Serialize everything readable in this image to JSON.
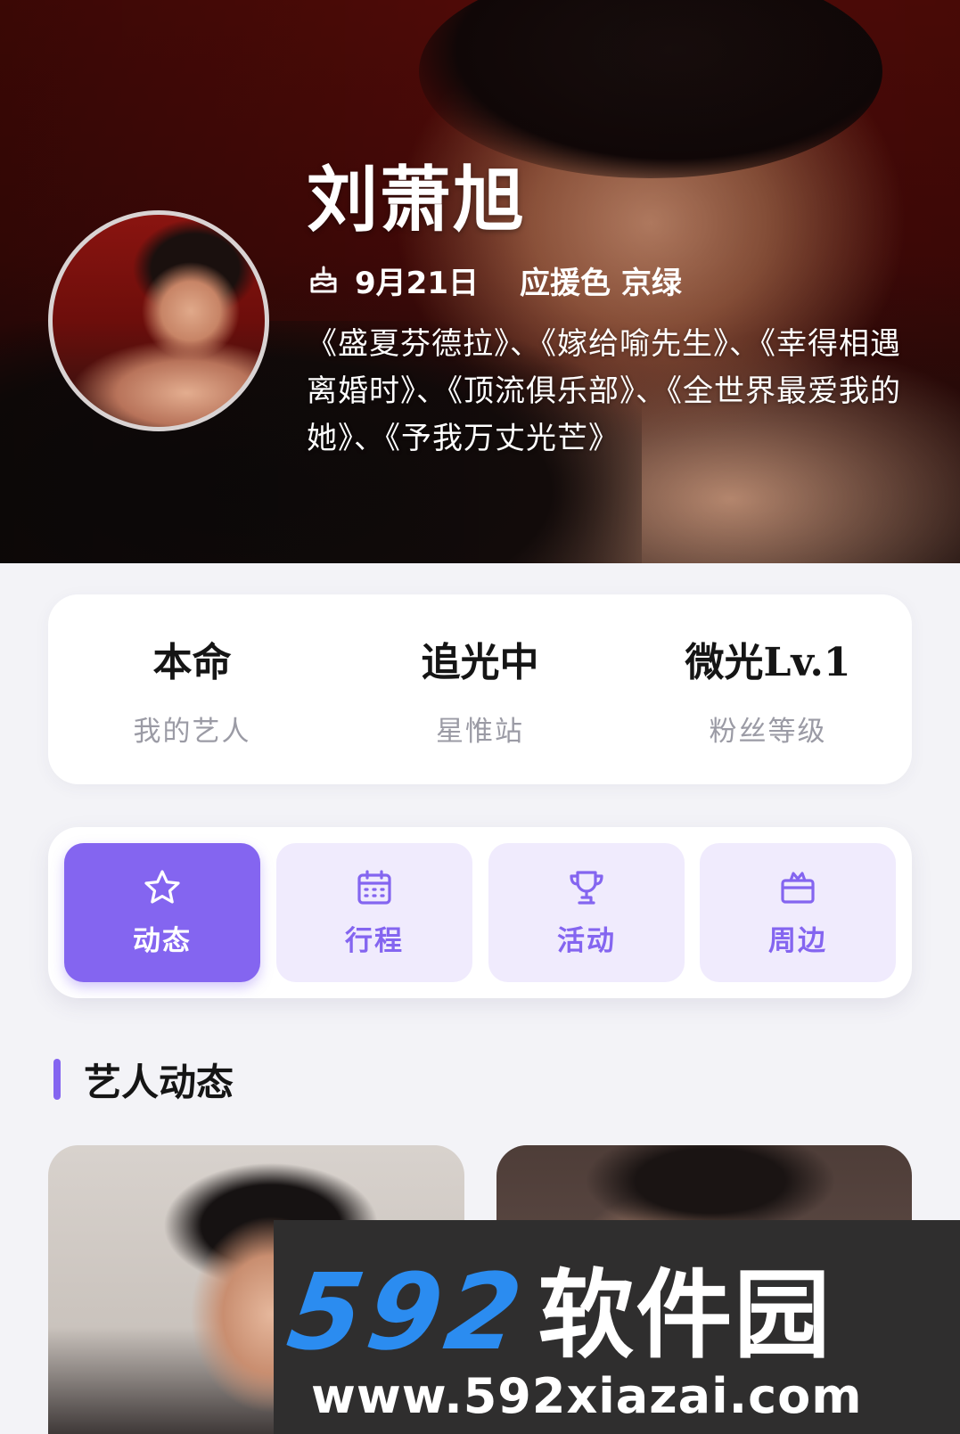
{
  "artist": {
    "name": "刘萧旭",
    "birthday": "9月21日",
    "support_color": "应援色 京绿",
    "works": "《盛夏芬德拉》、《嫁给喻先生》、《幸得相遇离婚时》、《顶流俱乐部》、《全世界最爱我的她》、《予我万丈光芒》"
  },
  "stats": [
    {
      "value": "本命",
      "label": "我的艺人"
    },
    {
      "value": "追光中",
      "label": "星惟站"
    },
    {
      "value": "微光Lv.1",
      "label": "粉丝等级"
    }
  ],
  "tabs": [
    {
      "label": "动态",
      "icon": "star-icon",
      "active": true
    },
    {
      "label": "行程",
      "icon": "calendar-icon",
      "active": false
    },
    {
      "label": "活动",
      "icon": "trophy-icon",
      "active": false
    },
    {
      "label": "周边",
      "icon": "gift-icon",
      "active": false
    }
  ],
  "section": {
    "title": "艺人动态"
  },
  "watermark": {
    "brand_number": "592",
    "brand_name": "软件园",
    "url": "www.592xiazai.com"
  },
  "colors": {
    "accent": "#8465f0",
    "accent_light": "#f0ebfd",
    "hero_bg": "#4a0a08",
    "page_bg": "#f3f3f7"
  }
}
